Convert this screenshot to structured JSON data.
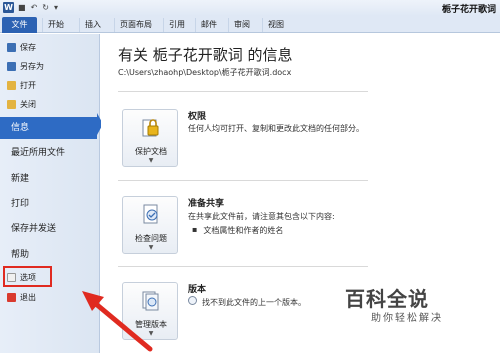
{
  "titlebar": {
    "app_icon_letter": "W",
    "window_title": "栀子花开歌词"
  },
  "ribbon": {
    "file_tab": "文件",
    "tabs": [
      "开始",
      "插入",
      "页面布局",
      "引用",
      "邮件",
      "审阅",
      "视图"
    ]
  },
  "nav": {
    "small_items": [
      {
        "label": "保存",
        "icon": "save-icon",
        "color": "#3c6fb4"
      },
      {
        "label": "另存为",
        "icon": "save-as-icon",
        "color": "#3c6fb4"
      },
      {
        "label": "打开",
        "icon": "folder-open-icon",
        "color": "#e3b341"
      },
      {
        "label": "关闭",
        "icon": "folder-close-icon",
        "color": "#e3b341"
      }
    ],
    "big_items": [
      "信息",
      "最近所用文件",
      "新建",
      "打印",
      "保存并发送",
      "帮助"
    ],
    "active": "信息",
    "bottom_items": [
      {
        "label": "选项",
        "icon": "options-icon",
        "color": "#f0f0f0"
      },
      {
        "label": "退出",
        "icon": "exit-icon",
        "color": "#d93a2e"
      }
    ]
  },
  "main": {
    "title": "有关 栀子花开歌词 的信息",
    "path": "C:\\Users\\zhaohp\\Desktop\\栀子花开歌词.docx",
    "sections": [
      {
        "button": "保护文档",
        "icon": "lock-icon",
        "title": "权限",
        "desc": "任何人均可打开、复制和更改此文档的任何部分。",
        "bullets": []
      },
      {
        "button": "检查问题",
        "icon": "checklist-icon",
        "title": "准备共享",
        "desc": "在共享此文件前，请注意其包含以下内容:",
        "bullets": [
          "文档属性和作者的姓名"
        ]
      },
      {
        "button": "管理版本",
        "icon": "versions-icon",
        "title": "版本",
        "desc": "找不到此文件的上一个版本。",
        "bullets": []
      }
    ]
  },
  "watermark": {
    "logo": "百科全说",
    "sub": "助你轻松解决"
  },
  "colors": {
    "accent": "#2e6bc4",
    "highlight": "#e02a20"
  }
}
